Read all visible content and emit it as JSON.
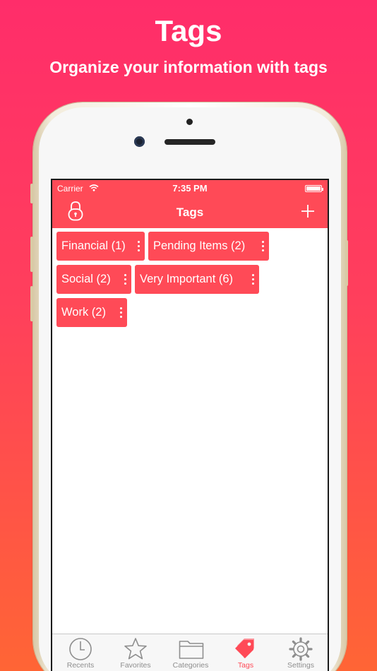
{
  "promo": {
    "title": "Tags",
    "subtitle": "Organize your information with tags"
  },
  "status_bar": {
    "carrier": "Carrier",
    "time": "7:35 PM"
  },
  "navbar": {
    "title": "Tags",
    "left_icon": "lock-icon",
    "right_icon": "plus-icon"
  },
  "tags": [
    {
      "label": "Financial (1)"
    },
    {
      "label": "Pending Items (2)"
    },
    {
      "label": "Social (2)"
    },
    {
      "label": "Very Important (6)"
    },
    {
      "label": "Work (2)"
    }
  ],
  "tabbar": {
    "items": [
      {
        "label": "Recents",
        "icon": "clock-icon"
      },
      {
        "label": "Favorites",
        "icon": "star-icon"
      },
      {
        "label": "Categories",
        "icon": "folder-icon"
      },
      {
        "label": "Tags",
        "icon": "tag-icon",
        "active": true
      },
      {
        "label": "Settings",
        "icon": "gear-icon"
      }
    ]
  },
  "colors": {
    "accent": "#ff4a57",
    "background_top": "#ff2d6a",
    "background_bottom": "#ff6535",
    "tab_inactive": "#8e8e8e"
  }
}
